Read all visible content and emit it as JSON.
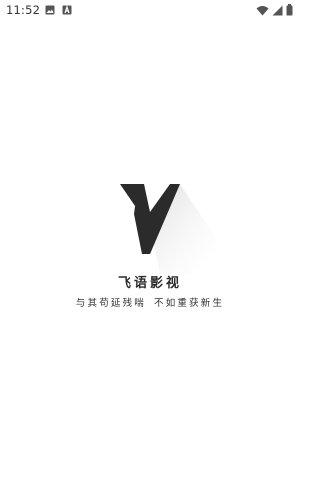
{
  "status_bar": {
    "time": "11:52",
    "left_icons": [
      "image-icon",
      "a-notification-icon"
    ],
    "right_icons": [
      "wifi-icon",
      "cell-signal-icon",
      "battery-icon"
    ]
  },
  "splash": {
    "logo_icon": "v-logo-icon",
    "app_name": "飞语影视",
    "slogan_part1": "与其苟延残喘",
    "slogan_part2": "不如重获新生"
  },
  "colors": {
    "background": "#ffffff",
    "logo": "#2b2b2b",
    "text": "#2b2b2b"
  }
}
